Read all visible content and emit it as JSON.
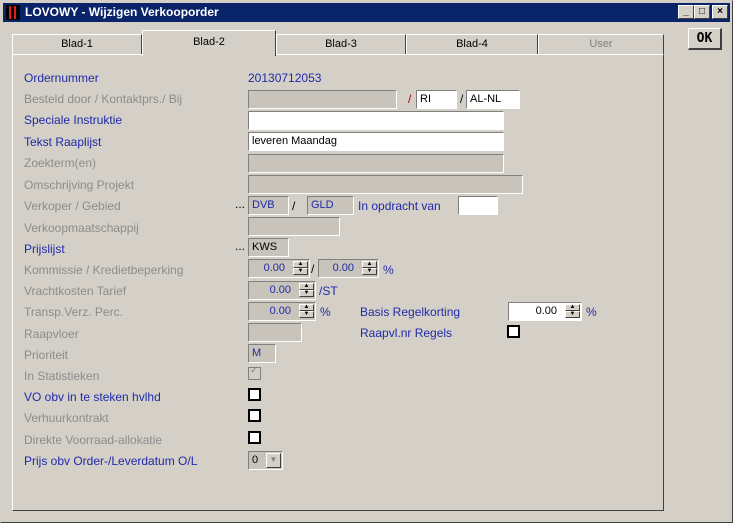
{
  "window": {
    "title": "LOVOWY - Wijzigen Verkooporder",
    "minimize": "_",
    "maximize": "□",
    "close": "×"
  },
  "toolbar": {
    "ok_label": "OK"
  },
  "tabs": [
    {
      "label": "Blad-1",
      "active": false,
      "disabled": false
    },
    {
      "label": "Blad-2",
      "active": true,
      "disabled": false
    },
    {
      "label": "Blad-3",
      "active": false,
      "disabled": false
    },
    {
      "label": "Blad-4",
      "active": false,
      "disabled": false
    },
    {
      "label": "User",
      "active": false,
      "disabled": true
    }
  ],
  "form": {
    "ordernummer": {
      "label": "Ordernummer",
      "value": "20130712053"
    },
    "besteld_door": {
      "label": "Besteld door / Kontaktprs./ Bij",
      "value": "",
      "sep1": "/",
      "kontakt": "RI",
      "sep2": "/",
      "bij": "AL-NL"
    },
    "speciale_instructie": {
      "label": "Speciale Instruktie",
      "value": ""
    },
    "tekst_raaplijst": {
      "label": "Tekst Raaplijst",
      "value": "leveren Maandag"
    },
    "zoekterm": {
      "label": "Zoekterm(en)",
      "value": ""
    },
    "omschrijving_projekt": {
      "label": "Omschrijving Projekt",
      "value": ""
    },
    "verkoper": {
      "label": "Verkoper / Gebied",
      "ellipsis": "...",
      "verkoper": "DVB",
      "sep": "/",
      "gebied": "GLD",
      "in_opdracht_label": "In opdracht van",
      "in_opdracht_value": ""
    },
    "verkoopmaatschappij": {
      "label": "Verkoopmaatschappij",
      "value": ""
    },
    "prijslijst": {
      "label": "Prijslijst",
      "ellipsis": "...",
      "value": "KWS"
    },
    "kommissie": {
      "label": "Kommissie / Kredietbeperking",
      "kommissie": "0.00",
      "sep": "/",
      "krediet": "0.00",
      "unit": "%"
    },
    "vrachtkosten": {
      "label": "Vrachtkosten Tarief",
      "value": "0.00",
      "unit": "/ST"
    },
    "transp": {
      "label": "Transp.Verz. Perc.",
      "value": "0.00",
      "unit": "%"
    },
    "basis_regelkorting": {
      "label": "Basis Regelkorting",
      "value": "0.00",
      "unit": "%"
    },
    "raapvloer": {
      "label": "Raapvloer",
      "value": ""
    },
    "raapvl_regels": {
      "label": "Raapvl.nr Regels",
      "checked": false
    },
    "prioriteit": {
      "label": "Prioriteit",
      "value": "M"
    },
    "in_statistieken": {
      "label": "In Statistieken",
      "checked": true,
      "mark": "✓"
    },
    "vo_obv": {
      "label": "VO obv in te steken hvlhd",
      "checked": false
    },
    "verhuurkontrakt": {
      "label": "Verhuurkontrakt",
      "checked": false
    },
    "direkte_voorraad": {
      "label": "Direkte Voorraad-allokatie",
      "checked": false
    },
    "prijs_obv": {
      "label": "Prijs obv Order-/Leverdatum O/L",
      "value": "0",
      "arrow": "▼"
    }
  }
}
